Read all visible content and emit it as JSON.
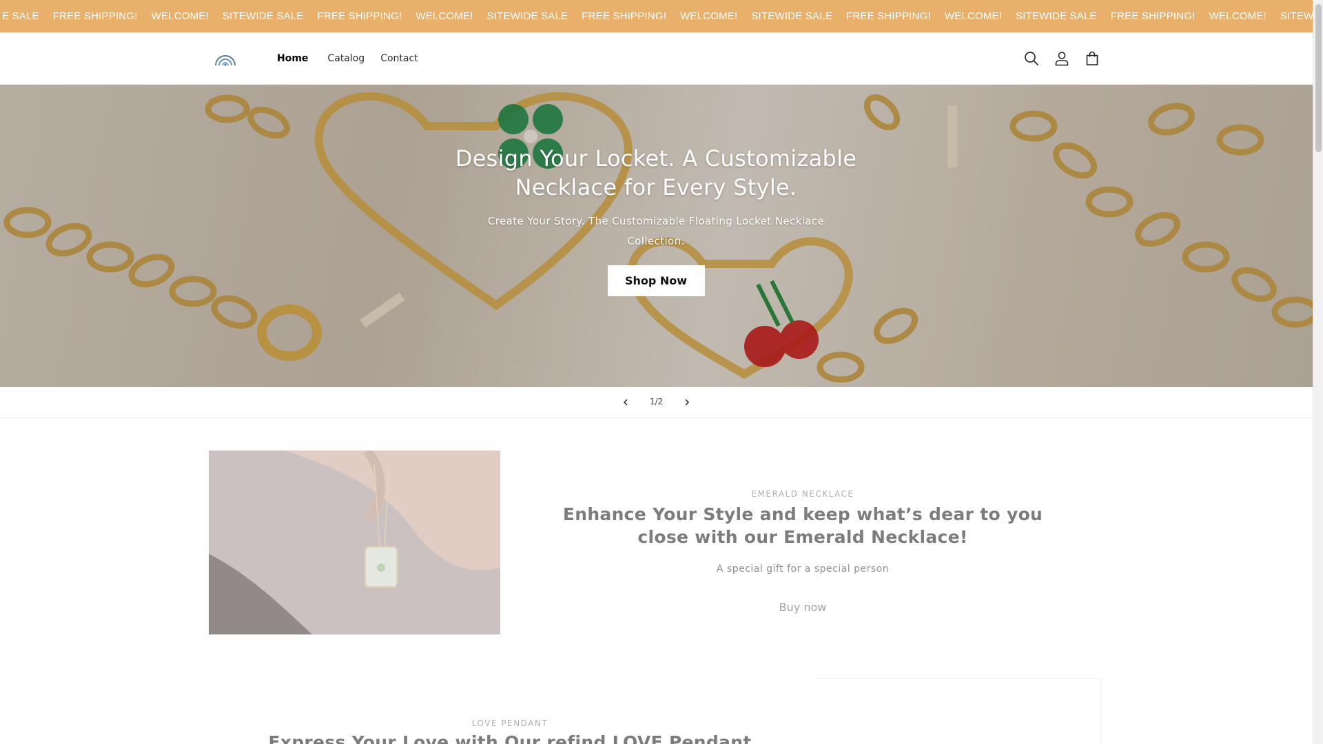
{
  "announcement": {
    "items": [
      "E SALE",
      "FREE SHIPPING!",
      "WELCOME!",
      "SITEWIDE SALE",
      "FREE SHIPPING!",
      "WELCOME!",
      "SITEWIDE SALE",
      "FREE SHIPPING!",
      "WELCOME!",
      "SITEWIDE SALE",
      "FREE SHIPPING!",
      "WELCOME!",
      "SITEWIDE SALE",
      "FREE SHIPPING!",
      "WELCOME!",
      "SITEWIDE S"
    ],
    "background": "#e8b06a"
  },
  "header": {
    "logo_icon": "rainbow-logo-icon",
    "nav": [
      {
        "label": "Home",
        "active": true
      },
      {
        "label": "Catalog",
        "active": false
      },
      {
        "label": "Contact",
        "active": false
      }
    ],
    "icons": [
      "search-icon",
      "account-icon",
      "cart-icon"
    ]
  },
  "hero": {
    "title": "Design Your Locket. A Customizable Necklace for Every Style.",
    "subtitle": "Create Your Story. The Customizable Floating Locket Necklace Collection.",
    "button_label": "Shop Now"
  },
  "slider": {
    "counter": "1/2",
    "prev_icon": "chevron-left-icon",
    "next_icon": "chevron-right-icon"
  },
  "feature_emerald": {
    "eyebrow": "EMERALD NECKLACE",
    "title": "Enhance Your Style and keep what’s dear to you close with our Emerald Necklace!",
    "subtitle": "A special gift for a special person",
    "link_label": "Buy now"
  },
  "feature_love": {
    "eyebrow": "LOVE PENDANT",
    "title": "Express Your Love with Our refind LOVE Pendant one of"
  }
}
